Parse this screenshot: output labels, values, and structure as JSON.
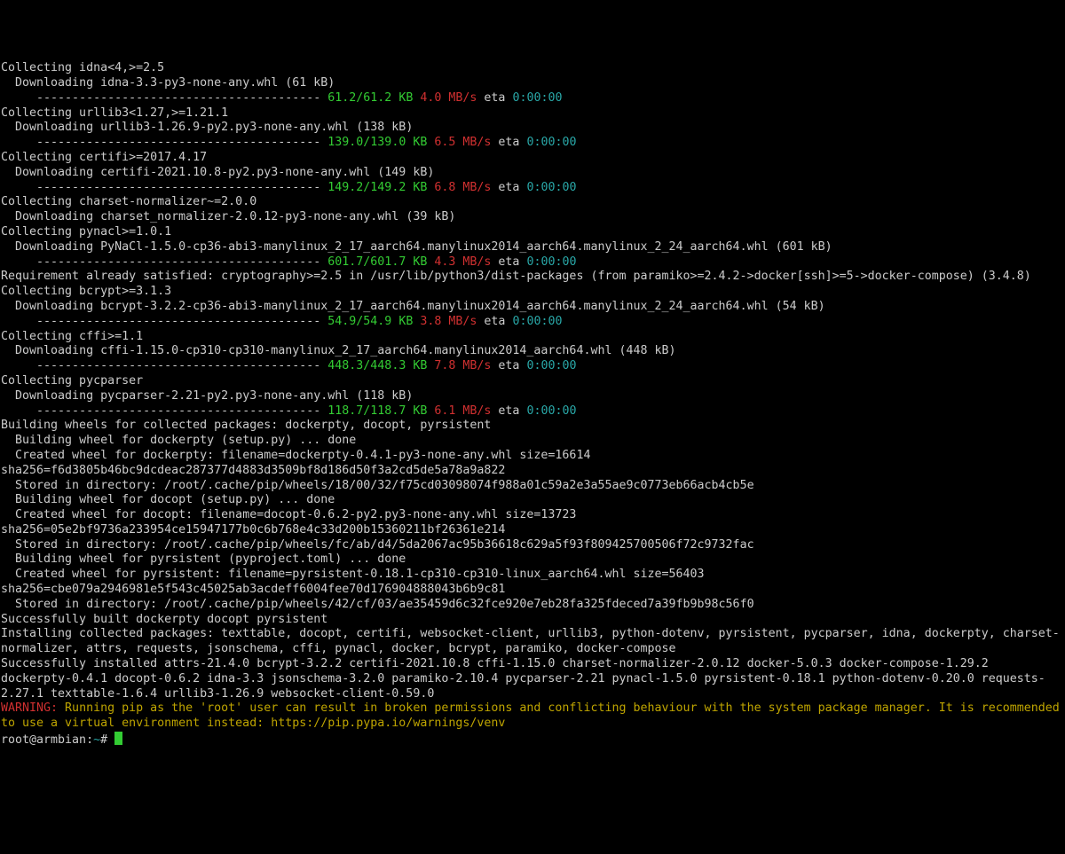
{
  "collect": [
    {
      "pkg": "idna<4,>=2.5",
      "dl": "Downloading idna-3.3-py3-none-any.whl (61 kB)",
      "prog": {
        "bytes": "61.2/61.2 KB",
        "speed": "4.0 MB/s",
        "eta": "0:00:00"
      }
    },
    {
      "pkg": "urllib3<1.27,>=1.21.1",
      "dl": "Downloading urllib3-1.26.9-py2.py3-none-any.whl (138 kB)",
      "prog": {
        "bytes": "139.0/139.0 KB",
        "speed": "6.5 MB/s",
        "eta": "0:00:00"
      }
    },
    {
      "pkg": "certifi>=2017.4.17",
      "dl": "Downloading certifi-2021.10.8-py2.py3-none-any.whl (149 kB)",
      "prog": {
        "bytes": "149.2/149.2 KB",
        "speed": "6.8 MB/s",
        "eta": "0:00:00"
      }
    }
  ],
  "charset": {
    "pkg": "charset-normalizer~=2.0.0",
    "dl": "Downloading charset_normalizer-2.0.12-py3-none-any.whl (39 kB)"
  },
  "pynacl": {
    "pkg": "pynacl>=1.0.1",
    "dl": "Downloading PyNaCl-1.5.0-cp36-abi3-manylinux_2_17_aarch64.manylinux2014_aarch64.manylinux_2_24_aarch64.whl (601 kB)",
    "prog": {
      "bytes": "601.7/601.7 KB",
      "speed": "4.3 MB/s",
      "eta": "0:00:00"
    }
  },
  "req_satisfied": "Requirement already satisfied: cryptography>=2.5 in /usr/lib/python3/dist-packages (from paramiko>=2.4.2->docker[ssh]>=5->docker-compose) (3.4.8)",
  "bcrypt": {
    "pkg": "bcrypt>=3.1.3",
    "dl": "Downloading bcrypt-3.2.2-cp36-abi3-manylinux_2_17_aarch64.manylinux2014_aarch64.manylinux_2_24_aarch64.whl (54 kB)",
    "prog": {
      "bytes": "54.9/54.9 KB",
      "speed": "3.8 MB/s",
      "eta": "0:00:00"
    }
  },
  "cffi": {
    "pkg": "cffi>=1.1",
    "dl": "Downloading cffi-1.15.0-cp310-cp310-manylinux_2_17_aarch64.manylinux2014_aarch64.whl (448 kB)",
    "prog": {
      "bytes": "448.3/448.3 KB",
      "speed": "7.8 MB/s",
      "eta": "0:00:00"
    }
  },
  "pycparser": {
    "pkg": "pycparser",
    "dl": "Downloading pycparser-2.21-py2.py3-none-any.whl (118 kB)",
    "prog": {
      "bytes": "118.7/118.7 KB",
      "speed": "6.1 MB/s",
      "eta": "0:00:00"
    }
  },
  "build_header": "Building wheels for collected packages: dockerpty, docopt, pyrsistent",
  "wheels": [
    {
      "build": "  Building wheel for dockerpty (setup.py) ... done",
      "created": "  Created wheel for dockerpty: filename=dockerpty-0.4.1-py3-none-any.whl size=16614 sha256=f6d3805b46bc9dcdeac287377d4883d3509bf8d186d50f3a2cd5de5a78a9a822",
      "stored": "  Stored in directory: /root/.cache/pip/wheels/18/00/32/f75cd03098074f988a01c59a2e3a55ae9c0773eb66acb4cb5e"
    },
    {
      "build": "  Building wheel for docopt (setup.py) ... done",
      "created": "  Created wheel for docopt: filename=docopt-0.6.2-py2.py3-none-any.whl size=13723 sha256=05e2bf9736a233954ce15947177b0c6b768e4c33d200b15360211bf26361e214",
      "stored": "  Stored in directory: /root/.cache/pip/wheels/fc/ab/d4/5da2067ac95b36618c629a5f93f809425700506f72c9732fac"
    },
    {
      "build": "  Building wheel for pyrsistent (pyproject.toml) ... done",
      "created": "  Created wheel for pyrsistent: filename=pyrsistent-0.18.1-cp310-cp310-linux_aarch64.whl size=56403 sha256=cbe079a2946981e5f543c45025ab3acdeff6004fee70d176904888043b6b9c81",
      "stored": "  Stored in directory: /root/.cache/pip/wheels/42/cf/03/ae35459d6c32fce920e7eb28fa325fdeced7a39fb9b98c56f0"
    }
  ],
  "built": "Successfully built dockerpty docopt pyrsistent",
  "installing": "Installing collected packages: texttable, docopt, certifi, websocket-client, urllib3, python-dotenv, pyrsistent, pycparser, idna, dockerpty, charset-normalizer, attrs, requests, jsonschema, cffi, pynacl, docker, bcrypt, paramiko, docker-compose",
  "installed": "Successfully installed attrs-21.4.0 bcrypt-3.2.2 certifi-2021.10.8 cffi-1.15.0 charset-normalizer-2.0.12 docker-5.0.3 docker-compose-1.29.2 dockerpty-0.4.1 docopt-0.6.2 idna-3.3 jsonschema-3.2.0 paramiko-2.10.4 pycparser-2.21 pynacl-1.5.0 pyrsistent-0.18.1 python-dotenv-0.20.0 requests-2.27.1 texttable-1.6.4 urllib3-1.26.9 websocket-client-0.59.0",
  "warning_label": "WARNING:",
  "warning_text": " Running pip as the 'root' user can result in broken permissions and conflicting behaviour with the system package manager. It is recommended to use a virtual environment instead: https://pip.pypa.io/warnings/venv",
  "prompt_user": "root@armbian",
  "prompt_path": "~",
  "eta_label": "eta",
  "dashes": "     ---------------------------------------- "
}
